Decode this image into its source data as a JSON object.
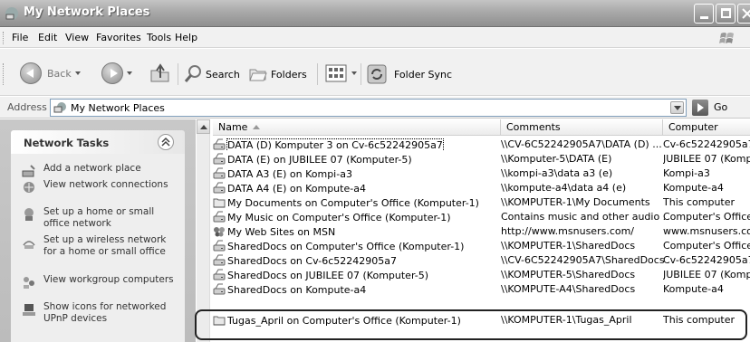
{
  "window": {
    "title": "My Network Places"
  },
  "menu": [
    "File",
    "Edit",
    "View",
    "Favorites",
    "Tools",
    "Help"
  ],
  "toolbar": {
    "back": "Back",
    "search": "Search",
    "folders": "Folders",
    "folder_sync": "Folder Sync"
  },
  "address": {
    "label": "Address",
    "value": "My Network Places",
    "go": "Go"
  },
  "task_pane": {
    "title": "Network Tasks",
    "tasks": [
      "Add a network place",
      "View network connections",
      "Set up a home or small office network",
      "Set up a wireless network for a home or small office",
      "View workgroup computers",
      "Show icons for networked UPnP devices"
    ]
  },
  "columns": {
    "name": "Name",
    "comments": "Comments",
    "computer": "Computer"
  },
  "rows": [
    {
      "name": "DATA (D) Komputer 3 on Cv-6c52242905a7",
      "comments": "\\\\CV-6C52242905A7\\DATA (D) ...",
      "computer": "Cv-6c52242905a7",
      "icon": "share-drive"
    },
    {
      "name": "DATA (E) on JUBILEE 07 (Komputer-5)",
      "comments": "\\\\Komputer-5\\DATA (E)",
      "computer": "JUBILEE 07 (Komp",
      "icon": "share-drive"
    },
    {
      "name": "DATA A3 (E) on Kompi-a3",
      "comments": "\\\\kompi-a3\\data a3 (e)",
      "computer": "Kompi-a3",
      "icon": "share-drive"
    },
    {
      "name": "DATA A4 (E) on Kompute-a4",
      "comments": "\\\\kompute-a4\\data a4 (e)",
      "computer": "Kompute-a4",
      "icon": "share-drive"
    },
    {
      "name": "My Documents on Computer's Office (Komputer-1)",
      "comments": "\\\\KOMPUTER-1\\My Documents",
      "computer": "This computer",
      "icon": "share-folder"
    },
    {
      "name": "My Music on Computer's Office (Komputer-1)",
      "comments": "Contains music and other audio ...",
      "computer": "Computer's Office",
      "icon": "share-drive"
    },
    {
      "name": "My Web Sites on MSN",
      "comments": "http://www.msnusers.com/",
      "computer": "www.msnusers.co",
      "icon": "msn"
    },
    {
      "name": "SharedDocs on Computer's Office (Komputer-1)",
      "comments": "\\\\KOMPUTER-1\\SharedDocs",
      "computer": "Computer's Office",
      "icon": "share-drive"
    },
    {
      "name": "SharedDocs on Cv-6c52242905a7",
      "comments": "\\\\CV-6C52242905A7\\SharedDocs",
      "computer": "Cv-6c52242905a7",
      "icon": "share-drive"
    },
    {
      "name": "SharedDocs on JUBILEE 07 (Komputer-5)",
      "comments": "\\\\KOMPUTER-5\\SharedDocs",
      "computer": "JUBILEE 07 (Komp",
      "icon": "share-drive"
    },
    {
      "name": "SharedDocs on Kompute-a4",
      "comments": "\\\\KOMPUTE-A4\\SharedDocs",
      "computer": "Kompute-a4",
      "icon": "share-drive"
    },
    {
      "name": "Tugas_April on Computer's Office (Komputer-1)",
      "comments": "\\\\KOMPUTER-1\\Tugas_April",
      "computer": "This computer",
      "icon": "share-folder"
    }
  ]
}
